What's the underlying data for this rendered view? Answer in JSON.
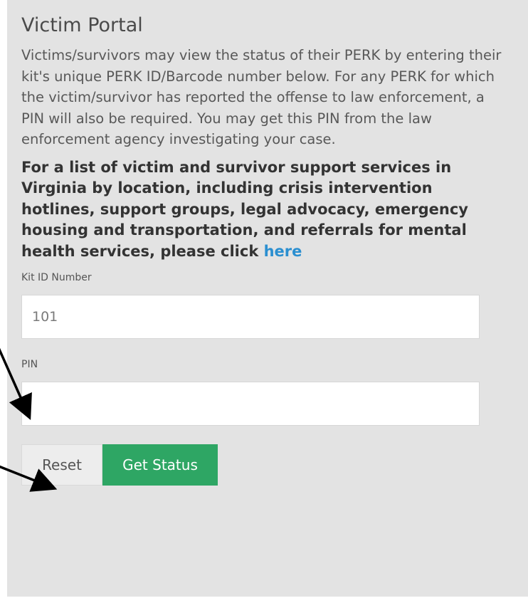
{
  "portal": {
    "title": "Victim Portal",
    "intro": "Victims/survivors may view the status of their PERK by entering their kit's unique PERK ID/Barcode number below. For any PERK for which the victim/survivor has reported the offense to law enforcement, a PIN will also be required. You may get this PIN from the law enforcement agency investigating your case.",
    "support_text": "For a list of victim and survivor support services in Virginia by location, including crisis intervention hotlines, support groups, legal advocacy, emergency housing and transportation, and referrals for mental health services, please click ",
    "support_link": "here"
  },
  "form": {
    "kit_label": "Kit ID Number",
    "kit_value": "101",
    "pin_label": "PIN",
    "pin_value": ""
  },
  "buttons": {
    "reset": "Reset",
    "get_status": "Get Status"
  },
  "colors": {
    "panel": "#e3e3e3",
    "link": "#2b8fd0",
    "primary_button": "#2ea664"
  }
}
